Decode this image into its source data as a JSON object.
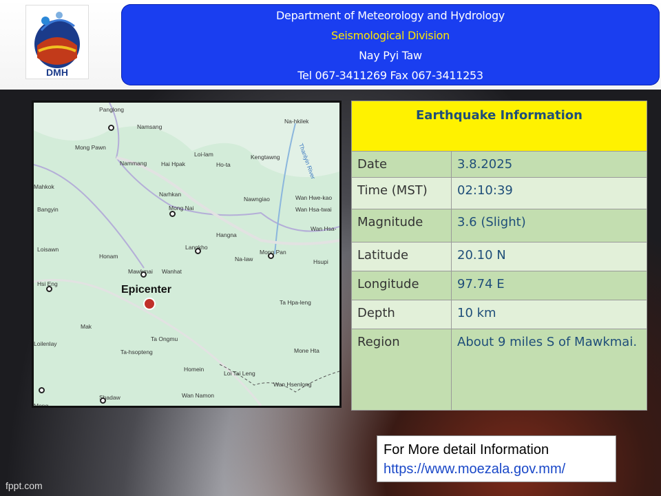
{
  "header": {
    "department": "Department of Meteorology and Hydrology",
    "division": "Seismological Division",
    "city": "Nay Pyi Taw",
    "contact": "Tel 067-3411269 Fax 067-3411253",
    "logo_text": "DMH"
  },
  "map": {
    "epicenter_label": "Epicenter",
    "places": [
      "Panglong",
      "Namsang",
      "Na-hkilek",
      "Mong Pawn",
      "Nammang",
      "Hai Hpak",
      "Loi-lam",
      "Ho-ta",
      "Kengtawng",
      "Thanlyin River",
      "Mahkok",
      "Narhkan",
      "Mong Nai",
      "Nawngiao",
      "Wan Hwe-kao",
      "Wan Hsa-twai",
      "Bangyin",
      "Hangna",
      "Wan Hsa-",
      "Langkho",
      "Na-law",
      "Mong Pan",
      "Loisawn",
      "Honam",
      "Mawkmai",
      "Wanhat",
      "Hsupi",
      "Hsi Eng",
      "Ta Hpa-leng",
      "Mak",
      "Ta Ongmu",
      "Loilenlay",
      "Ta-hsopteng",
      "Mone Hta",
      "Homein",
      "Loi Tai Leng",
      "Wan Hsenlong",
      "Wan Namon",
      "Shadaw",
      "Mong"
    ]
  },
  "info": {
    "title": "Earthquake Information",
    "rows": [
      {
        "key": "Date",
        "value": "3.8.2025"
      },
      {
        "key": "Time (MST)",
        "value": "02:10:39"
      },
      {
        "key": "Magnitude",
        "value": "3.6 (Slight)"
      },
      {
        "key": "Latitude",
        "value": "20.10 N"
      },
      {
        "key": "Longitude",
        "value": "97.74 E"
      },
      {
        "key": "Depth",
        "value": "10 km"
      },
      {
        "key": "Region",
        "value": "About 9 miles S of Mawkmai."
      }
    ]
  },
  "footer": {
    "line1": "For More detail Information",
    "url": "https://www.moezala.gov.mm/"
  },
  "watermark": "fppt.com"
}
